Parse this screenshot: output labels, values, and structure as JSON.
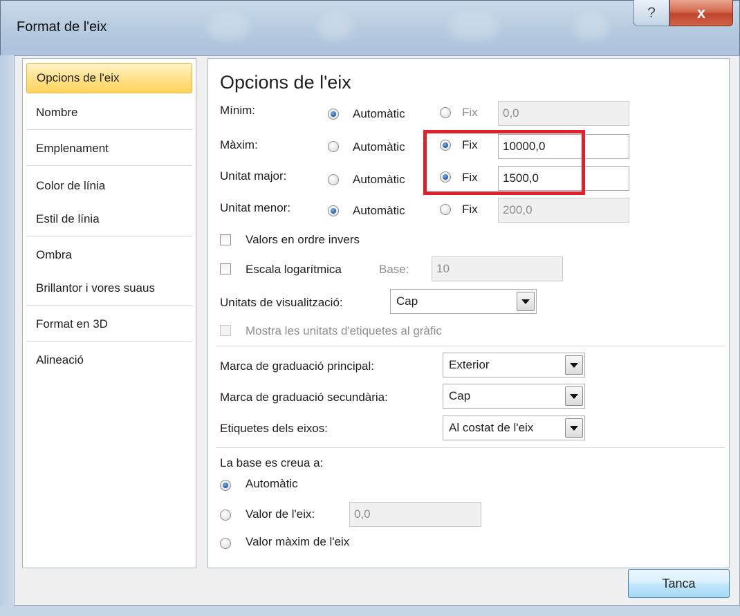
{
  "window": {
    "title": "Format de l'eix",
    "help_glyph": "?",
    "close_glyph": "x"
  },
  "nav": {
    "items": [
      {
        "label": "Opcions de l'eix",
        "selected": true
      },
      {
        "label": "Nombre"
      },
      {
        "label": "Emplenament"
      },
      {
        "label": "Color de línia"
      },
      {
        "label": "Estil de línia"
      },
      {
        "label": "Ombra"
      },
      {
        "label": "Brillantor i vores suaus"
      },
      {
        "label": "Format en 3D"
      },
      {
        "label": "Alineació"
      }
    ]
  },
  "panel": {
    "title": "Opcions de l'eix",
    "minimum": {
      "label": "Mínim:",
      "mode": "Automàtic",
      "value": "0,0"
    },
    "maximum": {
      "label": "Màxim:",
      "mode": "Fix",
      "value": "10000,0"
    },
    "major_unit": {
      "label": "Unitat major:",
      "mode": "Fix",
      "value": "1500,0"
    },
    "minor_unit": {
      "label": "Unitat menor:",
      "mode": "Automàtic",
      "value": "200,0"
    },
    "auto_label": "Automàtic",
    "fixed_label": "Fix",
    "reverse_order": {
      "label": "Valors en ordre invers",
      "checked": false
    },
    "log_scale": {
      "label": "Escala logarítmica",
      "checked": false,
      "base_label": "Base:",
      "base_value": "10"
    },
    "display_units": {
      "label": "Unitats de visualització:",
      "value": "Cap"
    },
    "show_units_label": {
      "label": "Mostra les unitats d'etiquetes al gràfic",
      "checked": false,
      "enabled": false
    },
    "major_tick": {
      "label": "Marca de graduació principal:",
      "value": "Exterior"
    },
    "minor_tick": {
      "label": "Marca de graduació secundària:",
      "value": "Cap"
    },
    "axis_labels": {
      "label": "Etiquetes dels eixos:",
      "value": "Al costat de l'eix"
    },
    "crosses": {
      "label": "La base es creua a:",
      "selected": "Automàtic",
      "options": [
        "Automàtic",
        "Valor de l'eix:",
        "Valor màxim de l'eix"
      ],
      "axis_value": "0,0"
    }
  },
  "footer": {
    "close_label": "Tanca"
  },
  "colors": {
    "highlight": "#e0202a",
    "selected_nav": "#ffe28a",
    "radio_checked": "#2a64a8"
  }
}
